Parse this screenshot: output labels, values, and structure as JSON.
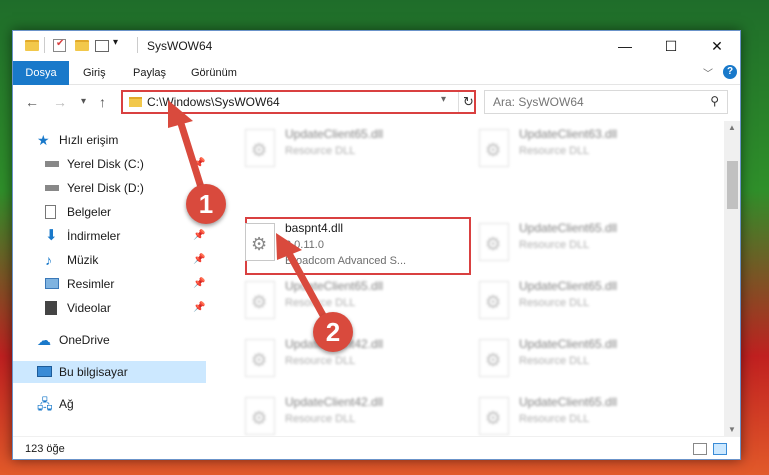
{
  "window": {
    "title": "SysWOW64",
    "controls": {
      "minimize": "—",
      "maximize": "☐",
      "close": "✕"
    }
  },
  "ribbon": {
    "tabs": [
      "Dosya",
      "Giriş",
      "Paylaş",
      "Görünüm"
    ],
    "active_tab": "Dosya",
    "help": "?"
  },
  "navbar": {
    "back": "←",
    "forward": "→",
    "recent": "▾",
    "up": "↑",
    "address": "C:\\Windows\\SysWOW64",
    "refresh": "↻",
    "search_placeholder": "Ara: SysWOW64"
  },
  "sidebar": {
    "items": [
      {
        "label": "Hızlı erişim",
        "icon": "star-icon",
        "pinned": false
      },
      {
        "label": "Yerel Disk (C:)",
        "icon": "drive-icon",
        "pinned": true
      },
      {
        "label": "Yerel Disk (D:)",
        "icon": "drive-icon",
        "pinned": true
      },
      {
        "label": "Belgeler",
        "icon": "document-icon",
        "pinned": true
      },
      {
        "label": "İndirmeler",
        "icon": "download-icon",
        "pinned": true
      },
      {
        "label": "Müzik",
        "icon": "music-icon",
        "pinned": true
      },
      {
        "label": "Resimler",
        "icon": "pictures-icon",
        "pinned": true
      },
      {
        "label": "Videolar",
        "icon": "video-icon",
        "pinned": true
      },
      {
        "label": "OneDrive",
        "icon": "cloud-icon",
        "pinned": false
      },
      {
        "label": "Bu bilgisayar",
        "icon": "computer-icon",
        "pinned": false,
        "selected": true
      },
      {
        "label": "Ağ",
        "icon": "network-icon",
        "pinned": false
      }
    ]
  },
  "files": [
    {
      "name": "UpdateClient65.dll",
      "line1": "Resource DLL",
      "line2": ""
    },
    {
      "name": "UpdateClient63.dll",
      "line1": "Resource DLL",
      "line2": ""
    },
    {
      "name": "baspnt4.dll",
      "line1": "3.0.11.0",
      "line2": "Broadcom Advanced S...",
      "highlighted": true
    },
    {
      "name": "UpdateClient65.dll",
      "line1": "Resource DLL",
      "line2": ""
    },
    {
      "name": "UpdateClient65.dll",
      "line1": "Resource DLL",
      "line2": ""
    },
    {
      "name": "UpdateClient65.dll",
      "line1": "Resource DLL",
      "line2": ""
    },
    {
      "name": "UpdateClient42.dll",
      "line1": "Resource DLL",
      "line2": ""
    },
    {
      "name": "UpdateClient65.dll",
      "line1": "Resource DLL",
      "line2": ""
    },
    {
      "name": "UpdateClient42.dll",
      "line1": "Resource DLL",
      "line2": ""
    },
    {
      "name": "UpdateClient65.dll",
      "line1": "Resource DLL",
      "line2": ""
    },
    {
      "name": "UpdateClient65.dll",
      "line1": "Resource DLL",
      "line2": ""
    },
    {
      "name": "UpdateClient65.dll",
      "line1": "Resource DLL",
      "line2": ""
    }
  ],
  "status": {
    "item_count": "123 öğe"
  },
  "annotations": {
    "step1": "1",
    "step2": "2"
  },
  "colors": {
    "accent": "#1979ca",
    "highlight_border": "#d94040",
    "badge": "#d94a3d"
  }
}
